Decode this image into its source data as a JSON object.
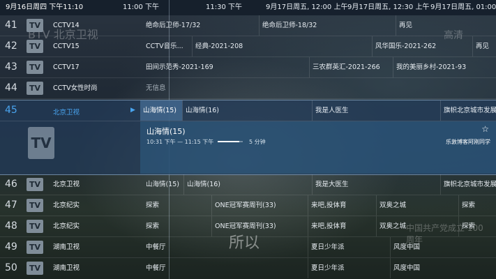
{
  "header": {
    "current_datetime": "9月16日周四 下午11:10",
    "timeslots": [
      "11:00 下午",
      "11:30 下午",
      "9月17日周五, 12:00 上午",
      "9月17日周五, 12:30 上午",
      "9月17日周五, 01:00 上午"
    ]
  },
  "rows_top": [
    {
      "num": "41",
      "name": "CCTV14",
      "programs": [
        "绝命后卫师-17/32",
        "绝命后卫师-18/32",
        "再见"
      ]
    },
    {
      "num": "42",
      "name": "CCTV15",
      "programs": [
        "CCTV音乐...",
        "经典-2021-208",
        "风华国乐-2021-262",
        "再见"
      ]
    },
    {
      "num": "43",
      "name": "CCTV17",
      "programs": [
        "田间示范秀-2021-169",
        "三农群英汇-2021-266",
        "我的美丽乡村-2021-93"
      ]
    },
    {
      "num": "44",
      "name": "CCTV女性时尚",
      "programs": [
        "无信息"
      ]
    }
  ],
  "selected": {
    "num": "45",
    "name": "北京卫视",
    "programs": [
      "山海情(15)",
      "山海情(16)",
      "我是人医生",
      "旗帜北京城市发展"
    ],
    "detail": {
      "title": "山海情(15)",
      "time": "10:31 下午 — 11:15 下午",
      "progress": 0.85,
      "remaining": "5 分钟",
      "credit": "乐敦博客阿刚同学"
    }
  },
  "rows_bottom": [
    {
      "num": "46",
      "name": "北京卫视",
      "programs": [
        "山海情(15)",
        "山海情(16)",
        "我是大医生",
        "旗帜北京城市发展"
      ]
    },
    {
      "num": "47",
      "name": "北京纪实",
      "programs": [
        "探索",
        "ONE冠军赛周刊(33)",
        "来吧,投体育",
        "双奥之城",
        "探索"
      ]
    },
    {
      "num": "48",
      "name": "北京纪实",
      "programs": [
        "探索",
        "ONE冠军赛周刊(33)",
        "来吧,投体育",
        "双奥之城",
        "探索"
      ]
    },
    {
      "num": "49",
      "name": "湖南卫视",
      "programs": [
        "中餐厅",
        "夏日少年派",
        "风度中国"
      ]
    },
    {
      "num": "50",
      "name": "湖南卫视",
      "programs": [
        "中餐厅",
        "夏日少年派",
        "风度中国"
      ]
    }
  ],
  "background_text": {
    "btv": "BTV 北京卫视",
    "subtitle": "所以",
    "anniv": "中国共产党成立 100周年",
    "tv_logo": "TV 海",
    "hd": "高清"
  }
}
